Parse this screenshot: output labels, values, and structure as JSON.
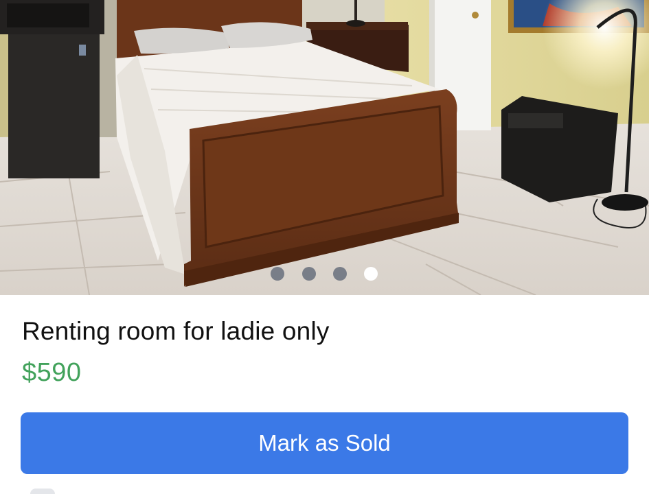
{
  "listing": {
    "title": "Renting room for ladie only",
    "price": "$590",
    "price_color": "#42a25b"
  },
  "carousel": {
    "photo_count": 4,
    "active_index": 3,
    "photo_description_icon": "bedroom-photo"
  },
  "actions": {
    "mark_sold_label": "Mark as Sold",
    "button_color": "#3b79e7"
  }
}
